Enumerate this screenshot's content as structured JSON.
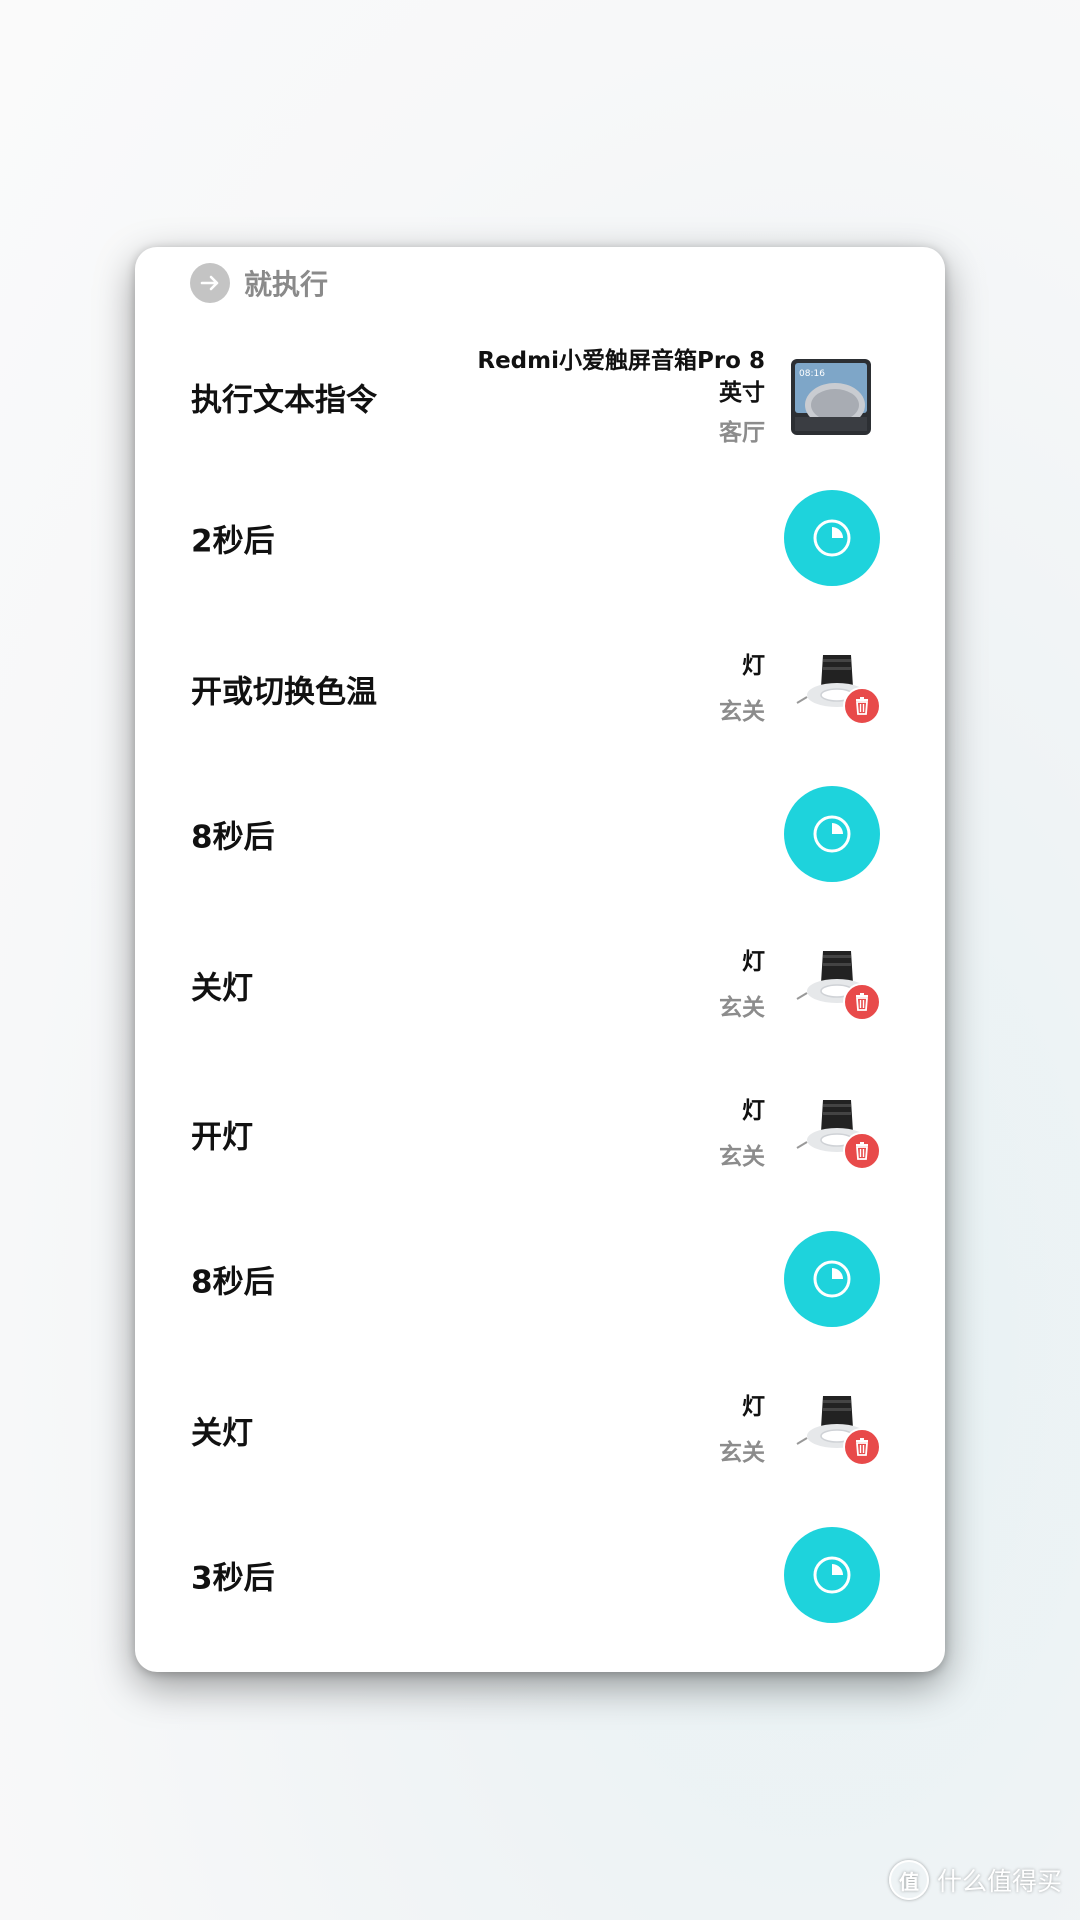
{
  "header": {
    "label": "就执行",
    "icon": "arrow-right-icon"
  },
  "actions": [
    {
      "type": "device",
      "title": "执行文本指令",
      "device_name": "Redmi小爱触屏音箱Pro 8英寸",
      "room": "客厅",
      "icon": "smart-display-icon",
      "screen_time": "08:16"
    },
    {
      "type": "delay",
      "title": "2秒后",
      "icon": "timer-icon"
    },
    {
      "type": "device",
      "title": "开或切换色温",
      "device_name": "灯",
      "room": "玄关",
      "icon": "downlight-icon"
    },
    {
      "type": "delay",
      "title": "8秒后",
      "icon": "timer-icon"
    },
    {
      "type": "device",
      "title": "关灯",
      "device_name": "灯",
      "room": "玄关",
      "icon": "downlight-icon"
    },
    {
      "type": "device",
      "title": "开灯",
      "device_name": "灯",
      "room": "玄关",
      "icon": "downlight-icon"
    },
    {
      "type": "delay",
      "title": "8秒后",
      "icon": "timer-icon"
    },
    {
      "type": "device",
      "title": "关灯",
      "device_name": "灯",
      "room": "玄关",
      "icon": "downlight-icon"
    },
    {
      "type": "delay",
      "title": "3秒后",
      "icon": "timer-icon"
    }
  ],
  "colors": {
    "timer_accent": "#1ed3dc",
    "delete_badge": "#e84a4a"
  },
  "watermark": {
    "mark": "值",
    "text": "什么值得买"
  }
}
